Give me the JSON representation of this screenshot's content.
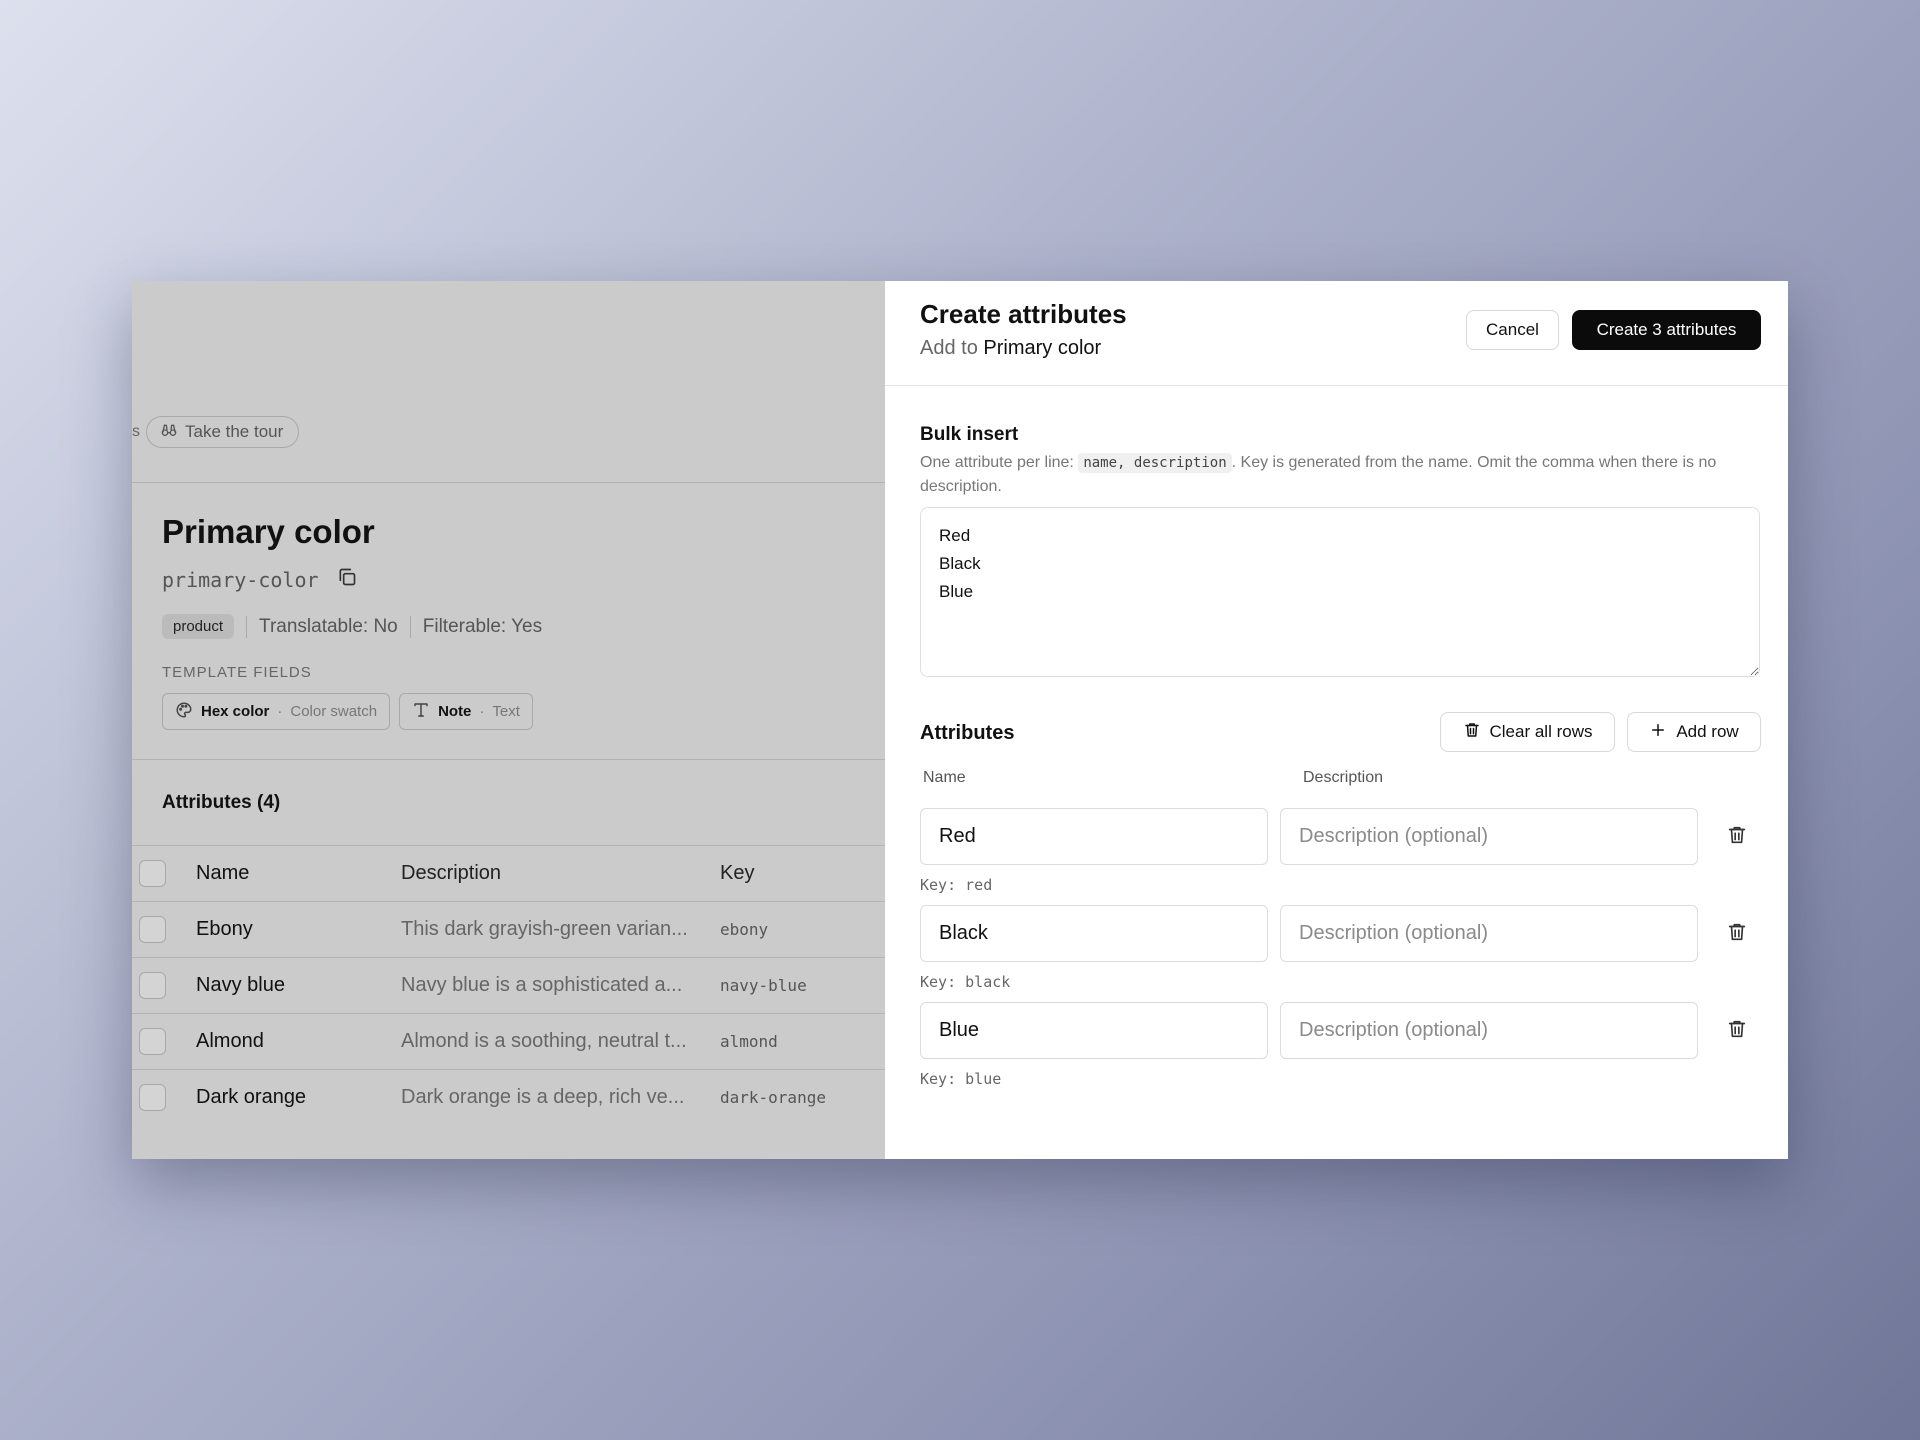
{
  "left": {
    "edge_fragment": "s",
    "tour_label": "Take the tour",
    "title": "Primary color",
    "slug": "primary-color",
    "tag": "product",
    "translatable": "Translatable: No",
    "filterable": "Filterable: Yes",
    "template_fields_label": "TEMPLATE FIELDS",
    "template_fields": [
      {
        "name": "Hex color",
        "sep": "·",
        "type": "Color swatch",
        "icon": "palette-icon"
      },
      {
        "name": "Note",
        "sep": "·",
        "type": "Text",
        "icon": "text-type-icon"
      }
    ],
    "attributes_heading": "Attributes (4)",
    "table": {
      "headers": {
        "name": "Name",
        "description": "Description",
        "key": "Key"
      },
      "rows": [
        {
          "name": "Ebony",
          "description": "This dark grayish-green varian...",
          "key": "ebony"
        },
        {
          "name": "Navy blue",
          "description": "Navy blue is a sophisticated a...",
          "key": "navy-blue"
        },
        {
          "name": "Almond",
          "description": "Almond is a soothing, neutral t...",
          "key": "almond"
        },
        {
          "name": "Dark orange",
          "description": "Dark orange is a deep, rich ve...",
          "key": "dark-orange"
        }
      ]
    }
  },
  "panel": {
    "title": "Create attributes",
    "subtitle_prefix": "Add to",
    "subtitle_target": "Primary color",
    "cancel_label": "Cancel",
    "create_label": "Create 3 attributes",
    "bulk": {
      "title": "Bulk insert",
      "help_before": "One attribute per line:",
      "help_code": "name, description",
      "help_after": ". Key is generated from the name. Omit the comma when there is no description.",
      "value": "Red\nBlack\nBlue"
    },
    "attributes": {
      "title": "Attributes",
      "clear_label": "Clear all rows",
      "add_label": "Add row",
      "col_name": "Name",
      "col_description": "Description",
      "desc_placeholder": "Description (optional)",
      "rows": [
        {
          "name": "Red",
          "key": "Key: red"
        },
        {
          "name": "Black",
          "key": "Key: black"
        },
        {
          "name": "Blue",
          "key": "Key: blue"
        }
      ]
    }
  },
  "colors": {
    "primary_button": "#0b0b0b",
    "overlay_gray": "#cbcbcb",
    "panel_bg": "#ffffff"
  }
}
